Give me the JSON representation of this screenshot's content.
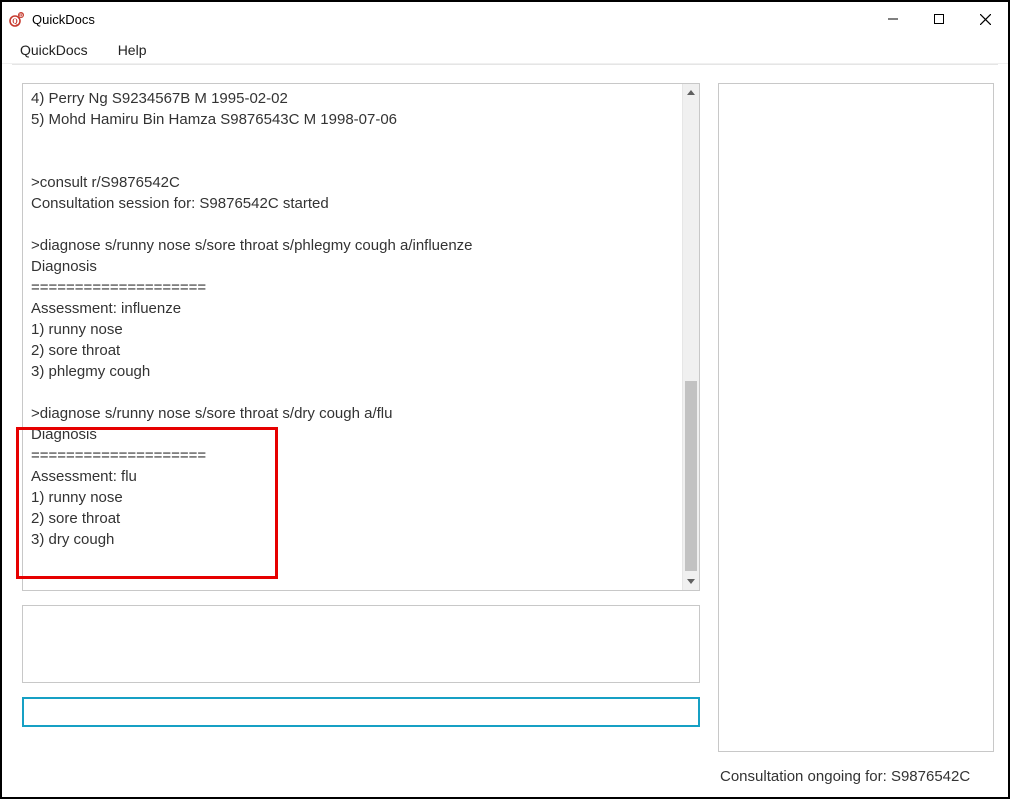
{
  "window": {
    "title": "QuickDocs"
  },
  "menu": {
    "quickdocs": "QuickDocs",
    "help": "Help"
  },
  "output_lines": [
    "4) Perry Ng S9234567B M 1995-02-02",
    "5) Mohd Hamiru Bin Hamza S9876543C M 1998-07-06",
    "",
    "",
    ">consult r/S9876542C",
    "Consultation session for: S9876542C started",
    "",
    ">diagnose s/runny nose s/sore throat s/phlegmy cough a/influenze",
    "Diagnosis",
    "====================",
    "Assessment: influenze",
    "1) runny nose",
    "2) sore throat",
    "3) phlegmy cough",
    "",
    ">diagnose s/runny nose s/sore throat s/dry cough a/flu",
    "Diagnosis",
    "====================",
    "Assessment: flu",
    "1) runny nose",
    "2) sore throat",
    "3) dry cough",
    ""
  ],
  "command_input": {
    "value": ""
  },
  "status": "Consultation ongoing for: S9876542C"
}
